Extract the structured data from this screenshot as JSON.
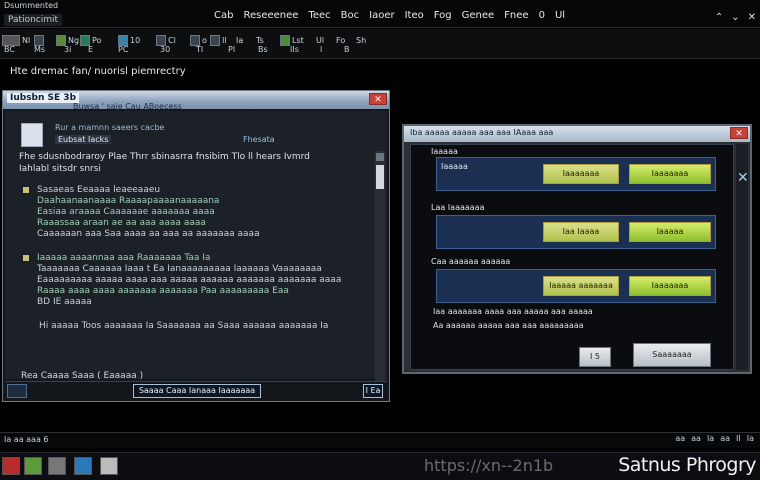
{
  "app": {
    "title": "Dsummented",
    "subtitle": "Pationcimit",
    "menu": [
      "Cab",
      "Reseeenee",
      "Teec",
      "Boc",
      "Iaoer",
      "Iteo",
      "Fog",
      "Genee",
      "Fnee",
      "0",
      "Ul"
    ],
    "window_controls": [
      "⌃",
      "⌄",
      "✕"
    ]
  },
  "toolbar": {
    "row1": [
      "Nl",
      "Ng",
      "Po",
      "10",
      "Cl",
      "o",
      "Il",
      "Ia",
      "Ts",
      "Lst",
      "Ul",
      "Fo",
      "Sh"
    ],
    "row2": [
      "BC",
      "Ms",
      "3i",
      "E",
      "PC",
      "30",
      "Tl",
      "Pl",
      "Bs",
      "IIs",
      "l",
      "B"
    ]
  },
  "path_label": "Hte dremac fan/ nuorisl piemrectry",
  "left_window": {
    "title": "Iubsbn SE 3b",
    "tabs": "Buwsa ' saie Cau ABoecess",
    "close": "✕",
    "tool1": "Rur a mamnn saeers cacbe",
    "tool2": "Eubsat Iacks",
    "tool3": "Fhesata",
    "head1": "Fhe sdusnbodraroy  Plae Thrr sbinasrra fnsibim   Tlo ll hears Ivmrd",
    "head2": "Iahlabl sitsdr snrsi",
    "section1": {
      "lines": [
        "Sasaeas Eeaaaa leaeeaaeu",
        "Daahaanaanaaaa Raaaapaaaanaaaaana",
        "Easiaa araaaa   Caaaaaae aaaaaaa aaaa",
        "Raaassaa araan  ae  aa aaa  aaaa aaaa",
        "Caaaaaan  aaa   Saa aaaa  aa  aaa aa aaaaaaa aaaa"
      ]
    },
    "section2": {
      "lines": [
        "Iaaaaa aaaannaa aaa Raaaaaaa Taa Ia",
        "Taaaaaaa Caaaaaa Iaaa t  Ea Ianaaaaaaaaa Iaaaaaa Vaaaaaaaa",
        "Eaaaaaaaaa  aaaaa aaaa   aaa aaaaa aaaaaa aaaaaaa aaaaaaa aaaa",
        "Raaaa aaaa    aaaa   aaaaaaa aaaaaaa  Paa  aaaaaaaaa  Eaa",
        "BD IE aaaaa"
      ]
    },
    "section3": "Hi aaaaa Toos aaaaaaa   Ia  Saaaaaaa aa Saaa  aaaaaa aaaaaaa Ia",
    "footer_text": "Rea  Caaaa Saaa  ( Eaaaaa )",
    "status_mid": "Saaaa Caaa Ianaaa Iaaaaaaa",
    "status_page": "I Ea"
  },
  "dialog": {
    "title": "Iba aaaaa aaaaa aaa aaa IAaaa aaa",
    "close": "✕",
    "group1_label": "Iaaaaa",
    "group1_caption": "Iaaaaa",
    "group1_opt_a": "Iaaaaaaa",
    "group1_opt_b": "Iaaaaaaa",
    "group2_label": "Laa Iaaaaaaa",
    "group2_opt_a": "Iaa Iaaaa",
    "group2_opt_b": "Iaaaaa",
    "group3_label": "Caa aaaaaa aaaaaa",
    "group3_opt_a": "Iaaaaa aaaaaaa",
    "group3_opt_b": "Iaaaaaaa",
    "note1": "Iaa  aaaaaaa aaaa aaa aaaaa aaa aaaaa",
    "note2": "Aa aaaaaa aaaaa aaa  aaa aaaaaaaaa",
    "btn_small": "I 5",
    "btn_main": "Saaaaaaa"
  },
  "status": {
    "left": "Ia  aa aaa 6",
    "right": [
      "aa",
      "aa",
      "Ia",
      "aa",
      "II",
      "Ia"
    ]
  },
  "taskbar": {
    "watermark": "https://xn--2n1b",
    "brand": "Satnus Phrogry"
  },
  "colors": {
    "accent": "#3d5f8e",
    "option_a": "#c7cf6a",
    "option_b": "#a9d447",
    "close": "#c9423a"
  }
}
